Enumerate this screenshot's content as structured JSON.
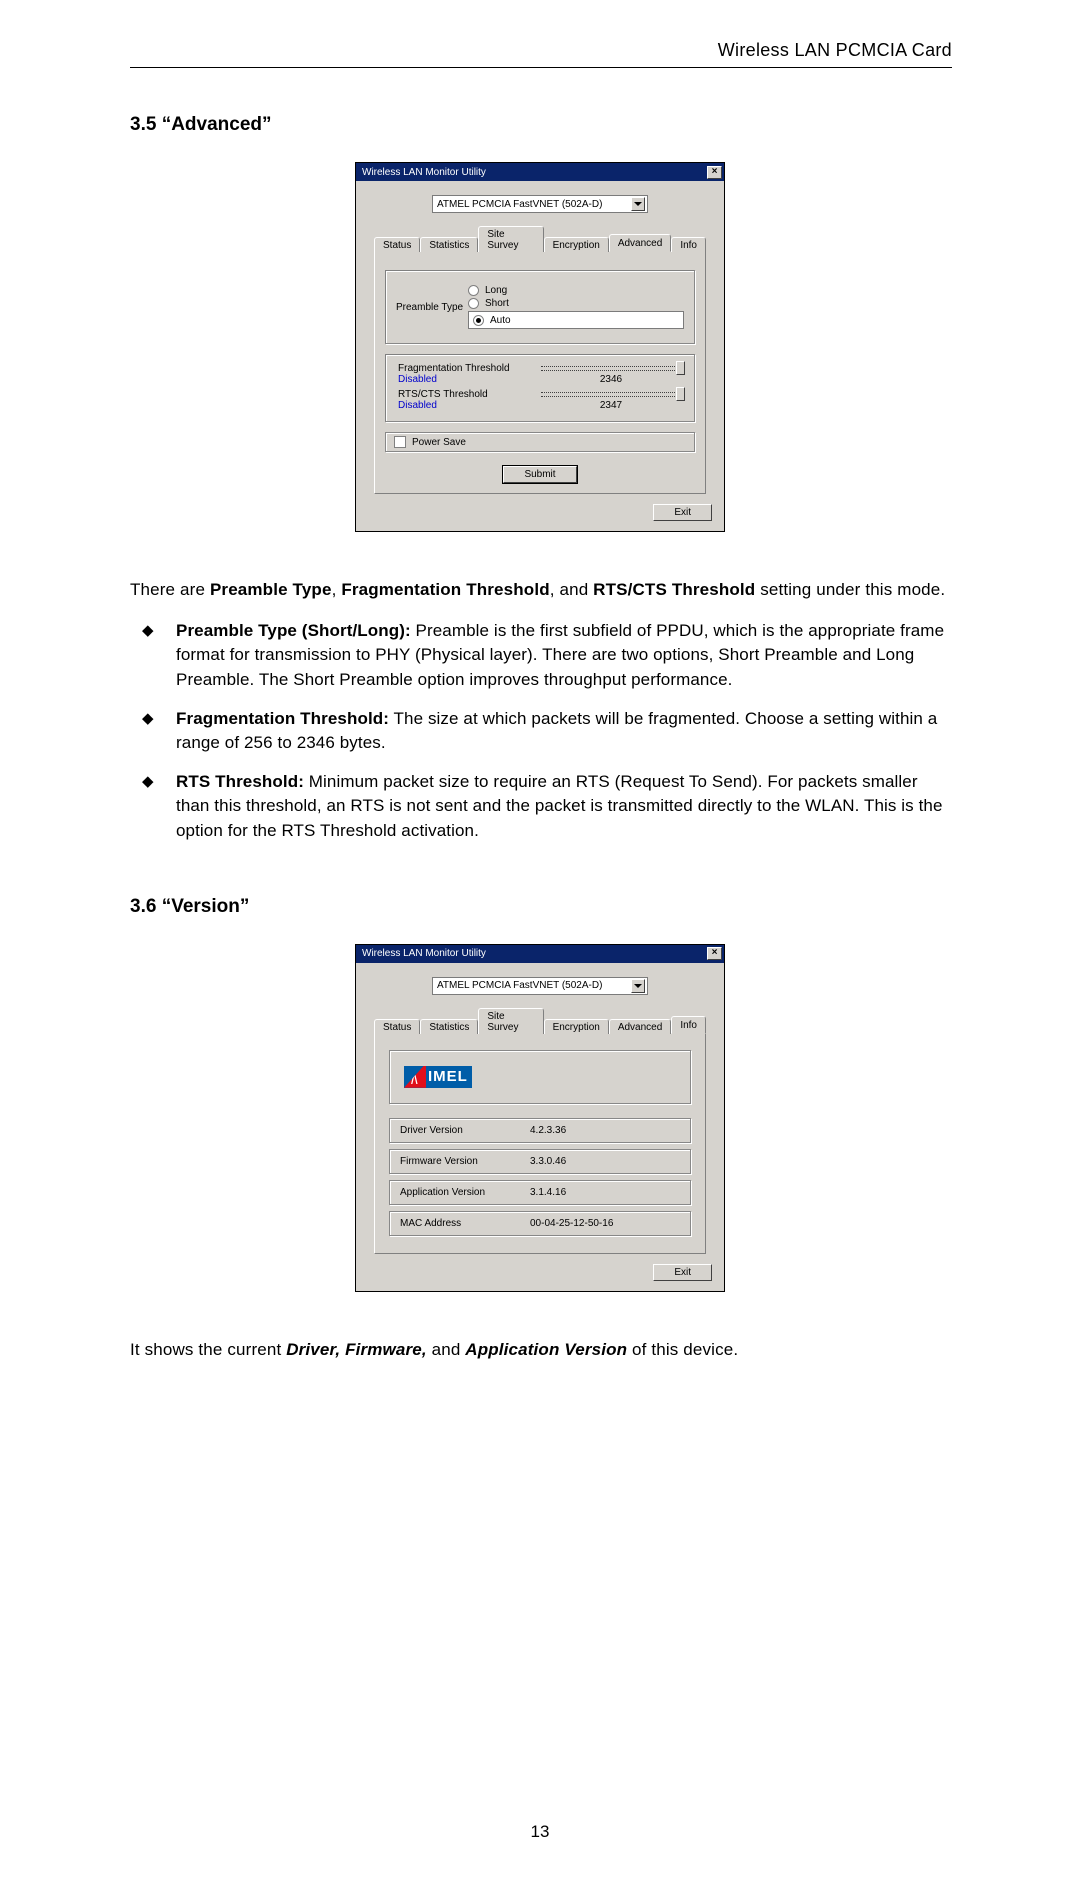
{
  "header": {
    "title": "Wireless LAN PCMCIA Card"
  },
  "section35": {
    "heading": "3.5  “Advanced”",
    "dialog": {
      "title": "Wireless LAN Monitor Utility",
      "device": "ATMEL PCMCIA FastVNET (502A-D)",
      "tabs": {
        "status": "Status",
        "statistics": "Statistics",
        "site_survey": "Site Survey",
        "encryption": "Encryption",
        "advanced": "Advanced",
        "info": "Info"
      },
      "preamble": {
        "label": "Preamble Type",
        "opt_long": "Long",
        "opt_short": "Short",
        "opt_auto": "Auto",
        "selected": "Auto"
      },
      "frag": {
        "label": "Fragmentation Threshold",
        "state": "Disabled",
        "value": "2346"
      },
      "rts": {
        "label": "RTS/CTS Threshold",
        "state": "Disabled",
        "value": "2347"
      },
      "power_save": "Power Save",
      "submit": "Submit",
      "exit": "Exit"
    },
    "intro": {
      "a": "There are ",
      "b": "Preamble Type",
      "c": ", ",
      "d": "Fragmentation Threshold",
      "e": ", and ",
      "f": "RTS/CTS Threshold",
      "g": " setting under this mode."
    },
    "bullets": {
      "p1": {
        "head": "Preamble Type (Short/Long):",
        "rest": " Preamble is the first subfield of PPDU, which is the appropriate frame format for transmission to PHY (Physical layer). There are two options, Short Preamble and Long Preamble. The Short Preamble option improves throughput performance."
      },
      "p2": {
        "head": "Fragmentation Threshold:",
        "rest": " The size at which packets will be fragmented. Choose a setting within a range of 256 to 2346 bytes."
      },
      "p3": {
        "head": "RTS Threshold:",
        "rest": " Minimum packet size to require an RTS (Request To Send). For packets smaller than this threshold, an RTS is not sent and the packet is transmitted directly to the WLAN. This is the option for the RTS Threshold activation."
      }
    }
  },
  "section36": {
    "heading": "3.6  “Version”",
    "dialog": {
      "title": "Wireless LAN Monitor Utility",
      "device": "ATMEL PCMCIA FastVNET (502A-D)",
      "tabs": {
        "status": "Status",
        "statistics": "Statistics",
        "site_survey": "Site Survey",
        "encryption": "Encryption",
        "advanced": "Advanced",
        "info": "Info"
      },
      "logo_text": "IMEL",
      "rows": {
        "driver": {
          "k": "Driver Version",
          "v": "4.2.3.36"
        },
        "firmware": {
          "k": "Firmware Version",
          "v": "3.3.0.46"
        },
        "app": {
          "k": "Application Version",
          "v": "3.1.4.16"
        },
        "mac": {
          "k": "MAC Address",
          "v": "00-04-25-12-50-16"
        }
      },
      "exit": "Exit"
    },
    "desc": {
      "a": "It shows the current ",
      "b": "Driver, Firmware,",
      "c": " and ",
      "d": "Application Version",
      "e": " of this device."
    }
  },
  "page_number": "13"
}
